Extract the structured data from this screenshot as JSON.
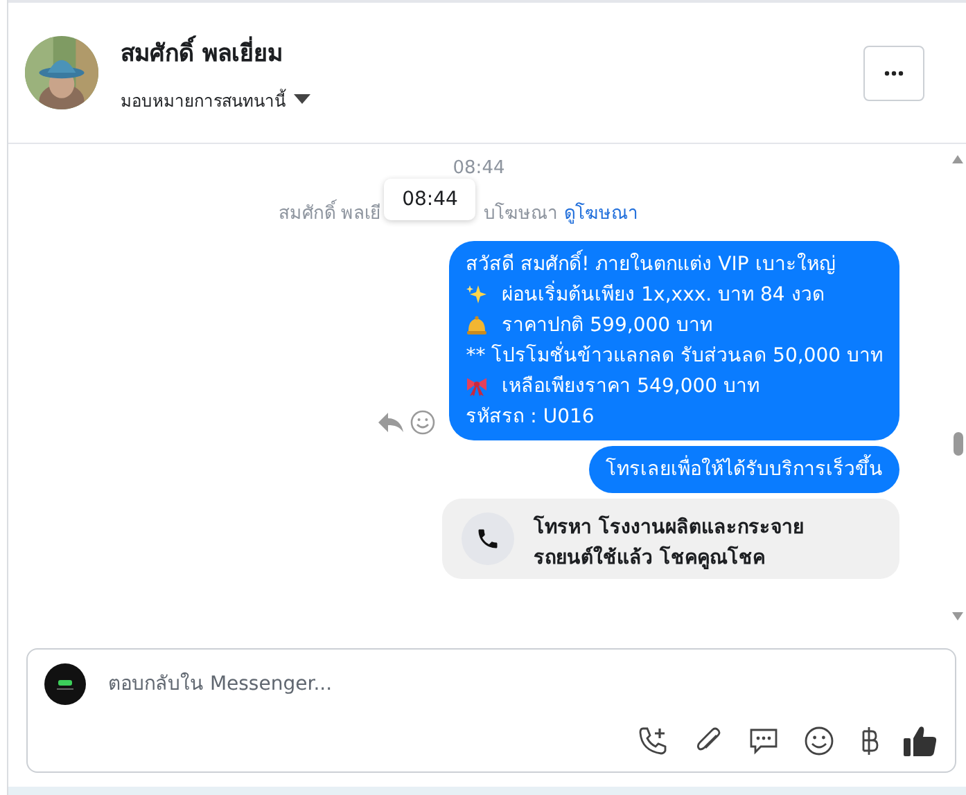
{
  "header": {
    "name": "สมศักดิ์ พลเยี่ยม",
    "assign": "มอบหมายการสนทนานี้"
  },
  "conversation": {
    "timestamp": "08:44",
    "notice_before": "สมศักดิ์ พลเยี",
    "notice_after": "บโฆษณา",
    "notice_link": "ดูโฆษณา",
    "tooltip": "08:44",
    "messages": [
      {
        "kind": "bubble",
        "lines": [
          {
            "kind": "plain",
            "text": "สวัสดี สมศักดิ์! ภายในตกแต่ง VIP เบาะใหญ่"
          },
          {
            "kind": "sparkle",
            "text": "ผ่อนเริ่มต้นเพียง 1x,xxx. บาท 84 งวด"
          },
          {
            "kind": "bell",
            "text": "ราคาปกติ 599,000 บาท"
          },
          {
            "kind": "plain",
            "text": "** โปรโมชั่นข้าวแลกลด รับส่วนลด 50,000 บาท"
          },
          {
            "kind": "ribbon",
            "text": "เหลือเพียงราคา 549,000 บาท"
          },
          {
            "kind": "plain",
            "text": "รหัสรถ : U016"
          }
        ]
      },
      {
        "kind": "bubble",
        "lines": [
          {
            "kind": "plain",
            "text": "โทรเลยเพื่อให้ได้รับบริการเร็วขึ้น"
          }
        ]
      },
      {
        "kind": "call",
        "lines": [
          {
            "text": "โทรหา โรงงานผลิตและกระจาย"
          },
          {
            "text": "รถยนต์ใช้แล้ว โชคคูณโชค"
          }
        ]
      }
    ]
  },
  "composer": {
    "placeholder": "ตอบกลับใน Messenger..."
  }
}
